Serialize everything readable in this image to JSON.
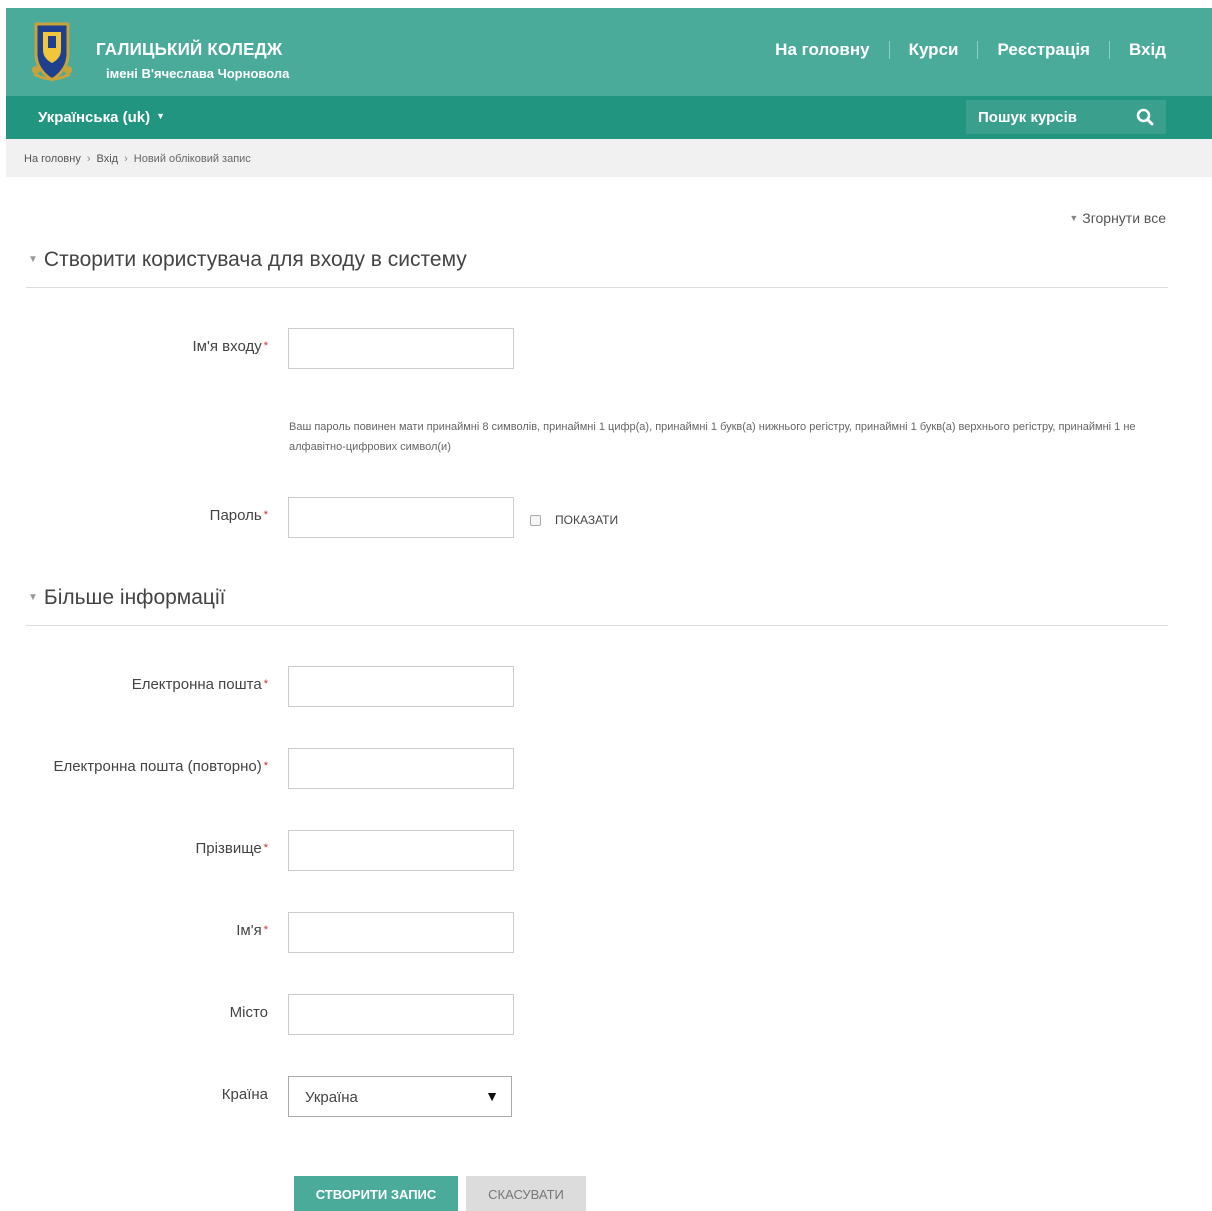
{
  "header": {
    "logo_line1": "ГАЛИЦЬКИЙ КОЛЕДЖ",
    "logo_line2": "імені В'ячеслава Чорновола",
    "nav": [
      {
        "label": "На головну"
      },
      {
        "label": "Курси"
      },
      {
        "label": "Реєстрація"
      },
      {
        "label": "Вхід"
      }
    ],
    "colors": {
      "primary": "#4aab9b",
      "secondary": "#219580"
    }
  },
  "subnav": {
    "language": "Українська (uk)",
    "search_placeholder": "Пошук курсів",
    "search_icon": "search-icon"
  },
  "breadcrumb": [
    "На головну",
    "Вхід",
    "Новий обліковий запис"
  ],
  "form": {
    "collapse_all": "Згорнути все",
    "section1_title": "Створити користувача для входу в систему",
    "username_label": "Ім'я входу",
    "password_hint": "Ваш пароль повинен мати принаймні 8 символів, принаймні 1 цифр(а), принаймні 1 букв(а) нижнього регістру, принаймні 1 букв(а) верхнього регістру, принаймні 1 не алфавітно-цифрових символ(и)",
    "password_label": "Пароль",
    "show_password_label": "ПОКАЗАТИ",
    "section2_title": "Більше інформації",
    "email_label": "Електронна пошта",
    "email_repeat_label": "Електронна пошта (повторно)",
    "surname_label": "Прізвище",
    "firstname_label": "Ім'я",
    "city_label": "Місто",
    "country_label": "Країна",
    "country_value": "Україна",
    "required_mark": "*",
    "submit_label": "СТВОРИТИ ЗАПИС",
    "cancel_label": "СКАСУВАТИ"
  }
}
